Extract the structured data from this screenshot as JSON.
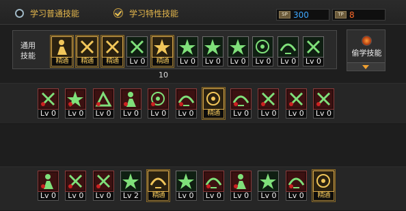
{
  "tabs": {
    "normal": "学习普通技能",
    "trait": "学习特性技能"
  },
  "points": {
    "sp_tag": "SP",
    "sp_value": "300",
    "tp_tag": "TP",
    "tp_value": "8"
  },
  "common": {
    "label": "通用技能",
    "cost_value": "10",
    "skills": [
      {
        "level": "精通",
        "style": "gold",
        "icon": "crouch-figure-icon"
      },
      {
        "level": "精通",
        "style": "gold",
        "icon": "leap-figure-icon"
      },
      {
        "level": "精通",
        "style": "gold",
        "icon": "kick-figure-icon"
      },
      {
        "level": "Lv 0",
        "style": "plain",
        "icon": "wings-icon"
      },
      {
        "level": "精通",
        "style": "gold",
        "icon": "target-burst-icon"
      },
      {
        "level": "Lv 0",
        "style": "plain",
        "icon": "target-icon"
      },
      {
        "level": "Lv 0",
        "style": "plain",
        "icon": "strike-arrow-icon"
      },
      {
        "level": "Lv 0",
        "style": "plain",
        "icon": "cloak-figure-icon"
      },
      {
        "level": "Lv 0",
        "style": "plain",
        "icon": "eye-icon"
      },
      {
        "level": "Lv 0",
        "style": "plain",
        "icon": "power-pose-icon"
      },
      {
        "level": "Lv 0",
        "style": "plain",
        "icon": "blade-icon"
      }
    ]
  },
  "steal": {
    "label": "偷学技能"
  },
  "row2": [
    {
      "level": "Lv 0",
      "style": "red",
      "icon": "skill-icon"
    },
    {
      "level": "Lv 0",
      "style": "red",
      "icon": "armor-figure-icon"
    },
    {
      "level": "Lv 0",
      "style": "red",
      "icon": "fireball-icon"
    },
    {
      "level": "Lv 0",
      "style": "red",
      "icon": "warrior-icon"
    },
    {
      "level": "Lv 0",
      "style": "red",
      "icon": "slash-arc-icon"
    },
    {
      "level": "Lv 0",
      "style": "red",
      "icon": "claw-icon"
    },
    {
      "level": "精通",
      "style": "gold",
      "icon": "whirlwind-icon"
    },
    {
      "level": "Lv 0",
      "style": "red",
      "icon": "dash-icon"
    },
    {
      "level": "Lv 0",
      "style": "red",
      "icon": "guard-icon"
    },
    {
      "level": "Lv 0",
      "style": "red",
      "icon": "spike-icon"
    },
    {
      "level": "Lv 0",
      "style": "red",
      "icon": "burst-icon"
    }
  ],
  "row3": [
    {
      "level": "Lv 0",
      "style": "red",
      "icon": "grapple-icon"
    },
    {
      "level": "Lv 0",
      "style": "red",
      "icon": "throw-icon"
    },
    {
      "level": "Lv 0",
      "style": "red",
      "icon": "ground-slam-icon"
    },
    {
      "level": "Lv 2",
      "style": "plain",
      "icon": "rising-icon"
    },
    {
      "level": "精通",
      "style": "gold",
      "icon": "hook-icon"
    },
    {
      "level": "Lv 0",
      "style": "plain",
      "icon": "arrow-strike-icon"
    },
    {
      "level": "Lv 0",
      "style": "red",
      "icon": "spin-icon"
    },
    {
      "level": "Lv 0",
      "style": "red",
      "icon": "tornado-icon"
    },
    {
      "level": "Lv 0",
      "style": "plain",
      "icon": "vortex-icon"
    },
    {
      "level": "Lv 0",
      "style": "red",
      "icon": "coil-icon"
    },
    {
      "level": "精通",
      "style": "gold",
      "icon": "lightning-icon"
    }
  ],
  "colors": {
    "gold": "#f1c65a",
    "sp": "#3ea8ff",
    "tp": "#ff6a2a",
    "icon_green": "#7fe07a"
  }
}
